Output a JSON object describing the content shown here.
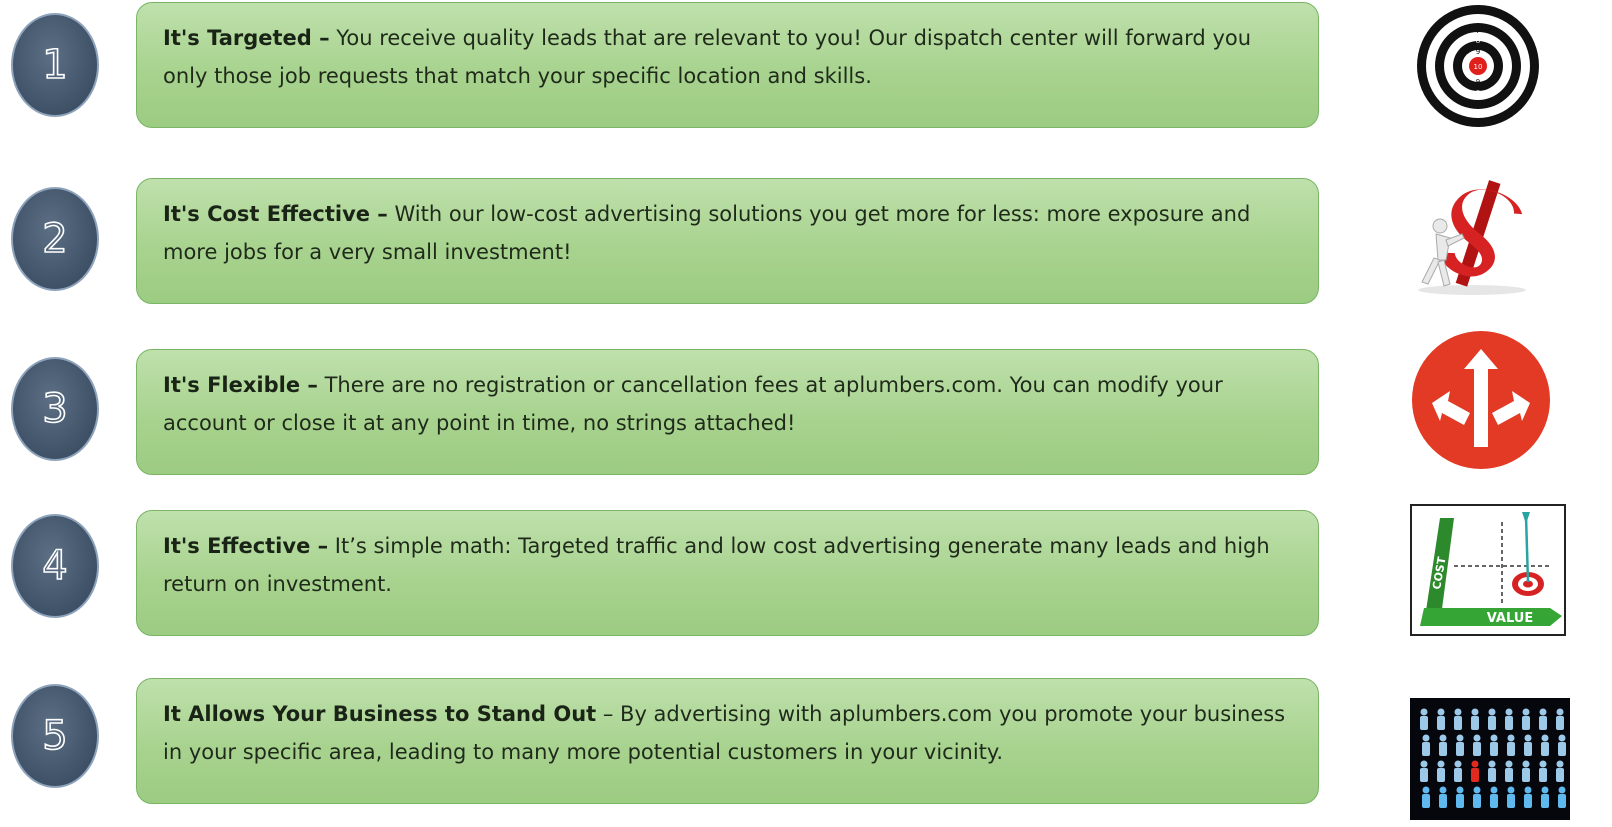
{
  "items": [
    {
      "number": "1",
      "title": "It's Targeted",
      "dash": " –",
      "text": " You receive quality leads that are relevant to you! Our dispatch center will forward you only those job requests that match your specific location and skills.",
      "icon": "target-icon"
    },
    {
      "number": "2",
      "title": "It's Cost Effective",
      "dash": " –",
      "text": " With our low-cost advertising solutions you get more for less: more exposure and more jobs for a very small investment!",
      "icon": "dollar-sign-icon"
    },
    {
      "number": "3",
      "title": "It's Flexible",
      "dash": " –",
      "text": " There are no registration or cancellation fees at aplumbers.com. You can modify your account or close it at any point in time, no strings attached!",
      "icon": "split-arrows-icon"
    },
    {
      "number": "4",
      "title": "It's Effective",
      "dash": " –",
      "text": " It’s simple math: Targeted traffic and low cost advertising generate many leads and high return on investment.",
      "icon": "cost-value-chart-icon"
    },
    {
      "number": "5",
      "title": "It Allows Your Business to Stand Out",
      "dash": " –",
      "text": " By advertising with aplumbers.com you promote your business in your specific area, leading to many more potential customers in your vicinity.",
      "icon": "crowd-standout-icon"
    }
  ],
  "target_ring_labels": [
    "5",
    "6",
    "7",
    "8",
    "9",
    "10"
  ],
  "chart_icon_labels": {
    "y": "COST",
    "x": "VALUE"
  },
  "colors": {
    "card_green": "#a8d38f",
    "card_border": "#7ab565",
    "circle_blue": "#3e5166",
    "target_red": "#e0201b",
    "arrow_badge_red": "#e23a24"
  }
}
